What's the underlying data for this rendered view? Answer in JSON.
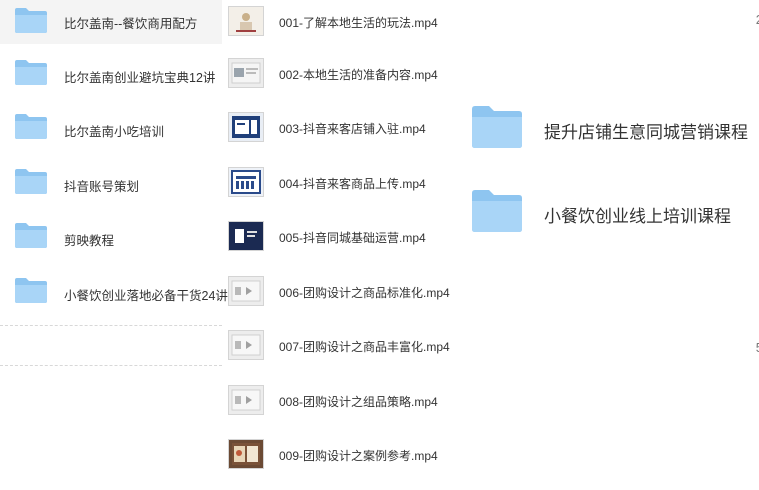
{
  "left_folders": [
    {
      "label": "比尔盖南--餐饮商用配方"
    },
    {
      "label": "比尔盖南创业避坑宝典12讲"
    },
    {
      "label": "比尔盖南小吃培训"
    },
    {
      "label": "抖音账号策划"
    },
    {
      "label": "剪映教程"
    },
    {
      "label": "小餐饮创业落地必备干货24讲"
    }
  ],
  "files": [
    {
      "label": "001-了解本地生活的玩法.mp4"
    },
    {
      "label": "002-本地生活的准备内容.mp4"
    },
    {
      "label": "003-抖音来客店铺入驻.mp4"
    },
    {
      "label": "004-抖音来客商品上传.mp4"
    },
    {
      "label": "005-抖音同城基础运营.mp4"
    },
    {
      "label": "006-团购设计之商品标准化.mp4"
    },
    {
      "label": "007-团购设计之商品丰富化.mp4"
    },
    {
      "label": "008-团购设计之组品策略.mp4"
    },
    {
      "label": "009-团购设计之案例参考.mp4"
    }
  ],
  "right_folders": [
    {
      "label": "提升店铺生意同城营销课程"
    },
    {
      "label": "小餐饮创业线上培训课程"
    }
  ],
  "edge_glyphs": [
    "2",
    "5"
  ],
  "colors": {
    "folder_back": "#8ec5f0",
    "folder_front": "#a9d5f7",
    "selected_row": "#f4f4f4"
  },
  "icons": {
    "folder": "folder-icon",
    "video": "video-thumbnail"
  }
}
